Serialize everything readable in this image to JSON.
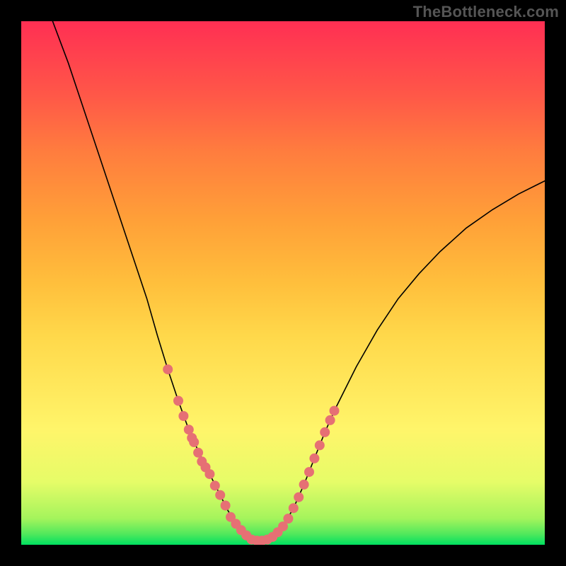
{
  "watermark": "TheBottleneck.com",
  "chart_data": {
    "type": "line",
    "title": "",
    "xlabel": "",
    "ylabel": "",
    "xlim": [
      0,
      1
    ],
    "ylim": [
      0,
      1
    ],
    "series": [
      {
        "name": "curve",
        "x": [
          0.06,
          0.09,
          0.12,
          0.15,
          0.18,
          0.21,
          0.24,
          0.26,
          0.28,
          0.3,
          0.32,
          0.34,
          0.36,
          0.38,
          0.395,
          0.41,
          0.425,
          0.44,
          0.46,
          0.48,
          0.5,
          0.52,
          0.54,
          0.56,
          0.58,
          0.6,
          0.64,
          0.68,
          0.72,
          0.76,
          0.8,
          0.85,
          0.9,
          0.95,
          1.0
        ],
        "y": [
          1.0,
          0.92,
          0.83,
          0.74,
          0.65,
          0.56,
          0.47,
          0.4,
          0.335,
          0.275,
          0.22,
          0.175,
          0.135,
          0.095,
          0.065,
          0.04,
          0.02,
          0.01,
          0.008,
          0.015,
          0.035,
          0.07,
          0.115,
          0.165,
          0.215,
          0.26,
          0.34,
          0.41,
          0.47,
          0.518,
          0.56,
          0.605,
          0.64,
          0.67,
          0.695
        ]
      },
      {
        "name": "dots",
        "x": [
          0.28,
          0.3,
          0.31,
          0.32,
          0.326,
          0.33,
          0.338,
          0.345,
          0.352,
          0.36,
          0.37,
          0.38,
          0.39,
          0.4,
          0.41,
          0.42,
          0.43,
          0.44,
          0.45,
          0.46,
          0.47,
          0.48,
          0.49,
          0.5,
          0.51,
          0.52,
          0.53,
          0.54,
          0.55,
          0.56,
          0.57,
          0.58,
          0.59,
          0.598
        ],
        "y": [
          0.335,
          0.275,
          0.246,
          0.22,
          0.204,
          0.196,
          0.176,
          0.159,
          0.148,
          0.135,
          0.113,
          0.095,
          0.075,
          0.053,
          0.04,
          0.028,
          0.018,
          0.01,
          0.008,
          0.008,
          0.01,
          0.015,
          0.024,
          0.035,
          0.05,
          0.07,
          0.091,
          0.115,
          0.139,
          0.165,
          0.19,
          0.215,
          0.238,
          0.256
        ]
      }
    ],
    "colors": {
      "curve": "#000000",
      "dots": "#e67074",
      "gradient_top": "#ff2f53",
      "gradient_bottom": "#00e060"
    }
  }
}
